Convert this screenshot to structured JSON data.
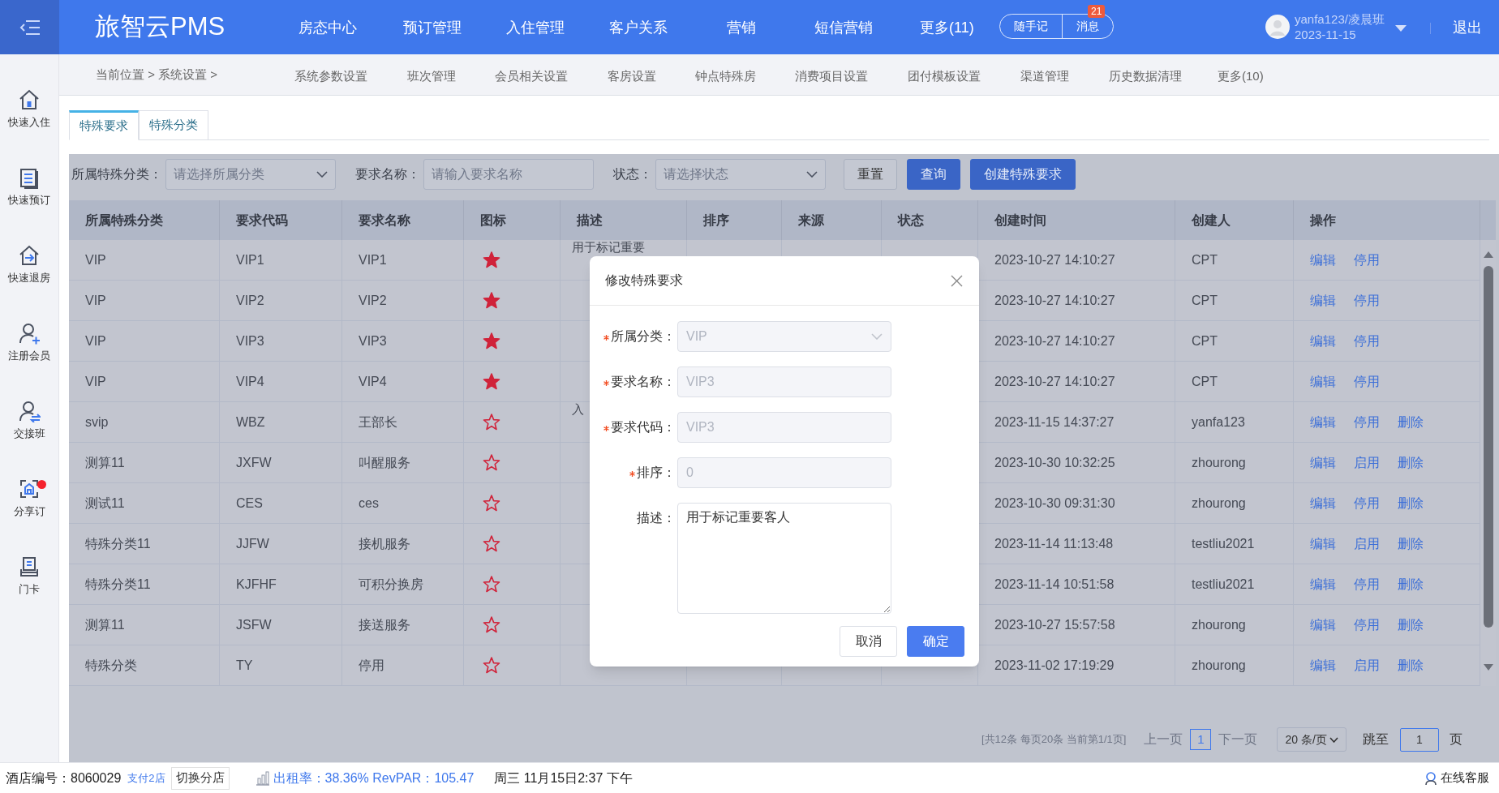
{
  "app_bar": {
    "logo": "旅智云PMS",
    "nav": [
      "房态中心",
      "预订管理",
      "入住管理",
      "客户关系",
      "营销",
      "短信营销",
      "更多(11)"
    ],
    "quick_buttons": [
      {
        "label": "随手记"
      },
      {
        "label": "消息",
        "badge": "21"
      }
    ],
    "user": {
      "name": "yanfa123/凌晨班",
      "date": "2023-11-15"
    },
    "logout": "退出"
  },
  "breadcrumb": "当前位置 > 系统设置 >",
  "sub_nav": [
    "系统参数设置",
    "班次管理",
    "会员相关设置",
    "客房设置",
    "钟点特殊房",
    "消费项目设置",
    "团付模板设置",
    "渠道管理",
    "历史数据清理",
    "更多(10)"
  ],
  "sidebar": [
    {
      "label": "快速入住",
      "kind": "home",
      "notification": false
    },
    {
      "label": "快速预订",
      "kind": "list",
      "notification": false
    },
    {
      "label": "快速退房",
      "kind": "checkout",
      "notification": false
    },
    {
      "label": "注册会员",
      "kind": "user-add",
      "notification": false
    },
    {
      "label": "交接班",
      "kind": "user-swap",
      "notification": false
    },
    {
      "label": "分享订",
      "kind": "share",
      "notification": true
    },
    {
      "label": "门卡",
      "kind": "card",
      "notification": false
    }
  ],
  "tabs": [
    {
      "label": "特殊要求",
      "selected": true
    },
    {
      "label": "特殊分类",
      "selected": false
    }
  ],
  "filters": [
    {
      "label": "所属特殊分类：",
      "kind": "select",
      "placeholder": "请选择所属分类"
    },
    {
      "label": "要求名称：",
      "kind": "input",
      "placeholder": "请输入要求名称"
    },
    {
      "label": "状态：",
      "kind": "select",
      "placeholder": "请选择状态"
    }
  ],
  "filter_buttons": [
    {
      "label": "重置",
      "kind": "default"
    },
    {
      "label": "查询",
      "kind": "primary"
    },
    {
      "label": "创建特殊要求",
      "kind": "primary"
    }
  ],
  "table": {
    "columns": [
      "所属特殊分类",
      "要求代码",
      "要求名称",
      "图标",
      "描述",
      "排序",
      "来源",
      "状态",
      "创建时间",
      "创建人",
      "操作"
    ],
    "rows": [
      {
        "category": "VIP",
        "code": "VIP1",
        "name": "VIP1",
        "star_filled": true,
        "description": "用于标记重要",
        "created": "2023-10-27 14:10:27",
        "creator": "CPT",
        "actions": [
          "编辑",
          "停用"
        ]
      },
      {
        "category": "VIP",
        "code": "VIP2",
        "name": "VIP2",
        "star_filled": true,
        "created": "2023-10-27 14:10:27",
        "creator": "CPT",
        "actions": [
          "编辑",
          "停用"
        ]
      },
      {
        "category": "VIP",
        "code": "VIP3",
        "name": "VIP3",
        "star_filled": true,
        "created": "2023-10-27 14:10:27",
        "creator": "CPT",
        "actions": [
          "编辑",
          "停用"
        ]
      },
      {
        "category": "VIP",
        "code": "VIP4",
        "name": "VIP4",
        "star_filled": true,
        "created": "2023-10-27 14:10:27",
        "creator": "CPT",
        "actions": [
          "编辑",
          "停用"
        ]
      },
      {
        "category": "svip",
        "code": "WBZ",
        "name": "王部长",
        "star_filled": false,
        "description": "入",
        "created": "2023-11-15 14:37:27",
        "creator": "yanfa123",
        "actions": [
          "编辑",
          "停用",
          "删除"
        ]
      },
      {
        "category": "测算11",
        "code": "JXFW",
        "name": "叫醒服务",
        "star_filled": false,
        "created": "2023-10-30 10:32:25",
        "creator": "zhourong",
        "actions": [
          "编辑",
          "启用",
          "删除"
        ]
      },
      {
        "category": "测试11",
        "code": "CES",
        "name": "ces",
        "star_filled": false,
        "created": "2023-10-30 09:31:30",
        "creator": "zhourong",
        "actions": [
          "编辑",
          "停用",
          "删除"
        ]
      },
      {
        "category": "特殊分类11",
        "code": "JJFW",
        "name": "接机服务",
        "star_filled": false,
        "created": "2023-11-14 11:13:48",
        "creator": "testliu2021",
        "actions": [
          "编辑",
          "启用",
          "删除"
        ]
      },
      {
        "category": "特殊分类11",
        "code": "KJFHF",
        "name": "可积分换房",
        "star_filled": false,
        "created": "2023-11-14 10:51:58",
        "creator": "testliu2021",
        "actions": [
          "编辑",
          "停用",
          "删除"
        ]
      },
      {
        "category": "测算11",
        "code": "JSFW",
        "name": "接送服务",
        "star_filled": false,
        "created": "2023-10-27 15:57:58",
        "creator": "zhourong",
        "actions": [
          "编辑",
          "停用",
          "删除"
        ]
      },
      {
        "category": "特殊分类",
        "code": "TY",
        "name": "停用",
        "star_filled": false,
        "created": "2023-11-02 17:19:29",
        "creator": "zhourong",
        "actions": [
          "编辑",
          "启用",
          "删除"
        ]
      }
    ]
  },
  "pagination": {
    "summary": "[共12条 每页20条 当前第1/1页]",
    "prev": "上一页",
    "pages": [
      {
        "label": "1",
        "selected": true
      }
    ],
    "next": "下一页",
    "page_size": "20 条/页",
    "jump_label": "跳至",
    "jump_value": "1",
    "unit": "页"
  },
  "modal": {
    "title": "修改特殊要求",
    "fields": [
      {
        "label": "所属分类：",
        "kind": "select",
        "required": true,
        "disabled": true,
        "value": "VIP"
      },
      {
        "label": "要求名称：",
        "kind": "input",
        "required": true,
        "disabled": true,
        "value": "VIP3"
      },
      {
        "label": "要求代码：",
        "kind": "input",
        "required": true,
        "disabled": true,
        "value": "VIP3"
      },
      {
        "label": "排序：",
        "kind": "input",
        "required": true,
        "disabled": true,
        "value": "0"
      },
      {
        "label": "描述：",
        "kind": "textarea",
        "required": false,
        "disabled": false,
        "value": "用于标记重要客人"
      }
    ],
    "buttons": [
      {
        "label": "取消",
        "kind": "default"
      },
      {
        "label": "确定",
        "kind": "primary"
      }
    ]
  },
  "status_bar": {
    "hotel_no": "酒店编号：8060029",
    "pay_link": "支付2店",
    "switch_button": "切换分店",
    "occupancy": "出租率：38.36% RevPAR：105.47",
    "datetime": "周三 11月15日2:37 下午",
    "support": "在线客服"
  }
}
